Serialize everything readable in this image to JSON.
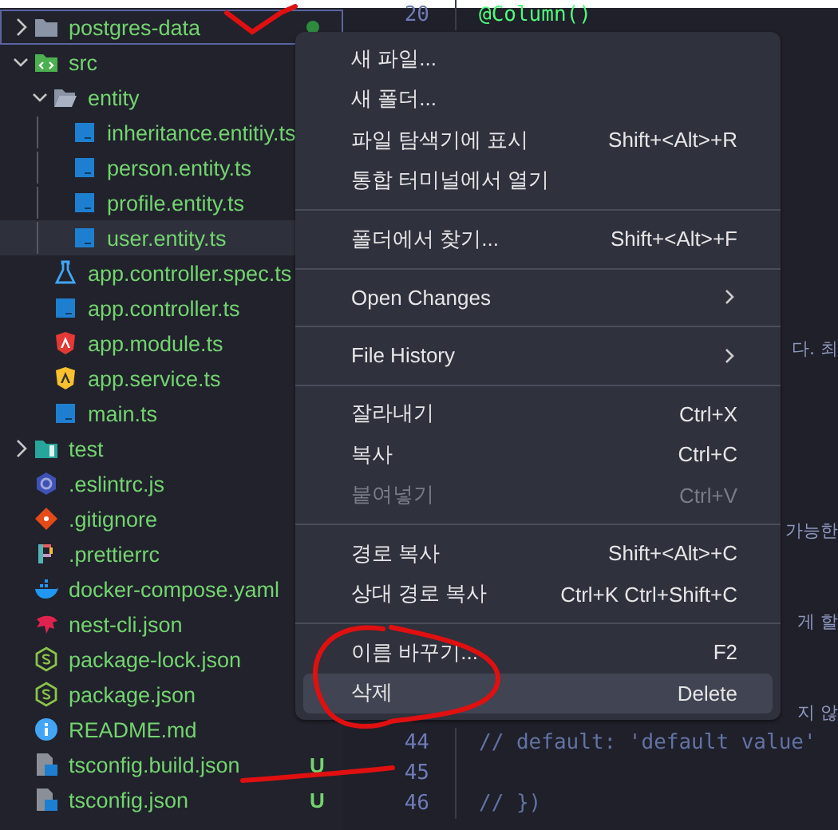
{
  "explorer": {
    "items": [
      {
        "label": "postgres-data",
        "kind": "folder",
        "expanded": false,
        "selected": false,
        "focused": true,
        "dot": true
      },
      {
        "label": "src",
        "kind": "source",
        "expanded": true,
        "selected": false,
        "focused": false,
        "children": [
          {
            "label": "entity",
            "kind": "folder",
            "expanded": true,
            "selected": false,
            "focused": false,
            "children": [
              {
                "label": "inheritance.entitiy.ts",
                "kind": "typescript",
                "selected": false,
                "focused": false
              },
              {
                "label": "person.entity.ts",
                "kind": "typescript",
                "selected": false,
                "focused": false
              },
              {
                "label": "profile.entity.ts",
                "kind": "typescript",
                "selected": false,
                "focused": false
              },
              {
                "label": "user.entity.ts",
                "kind": "typescript",
                "selected": true,
                "focused": false
              }
            ]
          },
          {
            "label": "app.controller.spec.ts",
            "kind": "flask",
            "selected": false,
            "focused": false
          },
          {
            "label": "app.controller.ts",
            "kind": "typescript",
            "selected": false,
            "focused": false
          },
          {
            "label": "app.module.ts",
            "kind": "module",
            "selected": false,
            "focused": false
          },
          {
            "label": "app.service.ts",
            "kind": "service",
            "selected": false,
            "focused": false
          },
          {
            "label": "main.ts",
            "kind": "typescript",
            "selected": false,
            "focused": false
          }
        ]
      },
      {
        "label": "test",
        "kind": "tests",
        "expanded": false,
        "selected": false,
        "focused": false
      },
      {
        "label": ".eslintrc.js",
        "kind": "eslint",
        "selected": false,
        "focused": false
      },
      {
        "label": ".gitignore",
        "kind": "git",
        "selected": false,
        "focused": false
      },
      {
        "label": ".prettierrc",
        "kind": "prettier",
        "selected": false,
        "focused": false
      },
      {
        "label": "docker-compose.yaml",
        "kind": "docker",
        "selected": false,
        "focused": false
      },
      {
        "label": "nest-cli.json",
        "kind": "nest",
        "selected": false,
        "focused": false
      },
      {
        "label": "package-lock.json",
        "kind": "node",
        "selected": false,
        "focused": false
      },
      {
        "label": "package.json",
        "kind": "node",
        "selected": false,
        "focused": false
      },
      {
        "label": "README.md",
        "kind": "info",
        "selected": false,
        "focused": false
      },
      {
        "label": "tsconfig.build.json",
        "kind": "config",
        "selected": false,
        "focused": false,
        "badge": "U"
      },
      {
        "label": "tsconfig.json",
        "kind": "config",
        "selected": false,
        "focused": false,
        "badge": "U"
      }
    ]
  },
  "editor": {
    "lines": [
      {
        "kind": "code",
        "number": "20",
        "text": "@Column()"
      },
      {
        "kind": "covered"
      },
      {
        "kind": "covered"
      },
      {
        "kind": "covered"
      },
      {
        "kind": "covered"
      },
      {
        "kind": "covered"
      },
      {
        "kind": "covered"
      },
      {
        "kind": "covered"
      },
      {
        "kind": "covered"
      },
      {
        "kind": "covered"
      },
      {
        "kind": "covered"
      },
      {
        "kind": "fragment",
        "text": "다. 최"
      },
      {
        "kind": "covered"
      },
      {
        "kind": "covered"
      },
      {
        "kind": "covered"
      },
      {
        "kind": "covered"
      },
      {
        "kind": "covered"
      },
      {
        "kind": "fragment",
        "text": "가능한"
      },
      {
        "kind": "covered"
      },
      {
        "kind": "covered"
      },
      {
        "kind": "fragment",
        "text": "게 할"
      },
      {
        "kind": "covered"
      },
      {
        "kind": "covered"
      },
      {
        "kind": "fragment",
        "text": "지 않"
      },
      {
        "kind": "comment",
        "number": "44",
        "text": "//    default: 'default value'"
      },
      {
        "kind": "code",
        "number": "45"
      },
      {
        "kind": "comment",
        "number": "46",
        "text": "// })"
      }
    ]
  },
  "context_menu": {
    "groups": [
      [
        {
          "label": "새 파일...",
          "selected": false,
          "disabled": false
        },
        {
          "label": "새 폴더...",
          "selected": false,
          "disabled": false
        },
        {
          "label": "파일 탐색기에 표시",
          "shortcut": "Shift+<Alt>+R",
          "selected": false,
          "disabled": false
        },
        {
          "label": "통합 터미널에서 열기",
          "selected": false,
          "disabled": false
        }
      ],
      [
        {
          "label": "폴더에서 찾기...",
          "shortcut": "Shift+<Alt>+F",
          "selected": false,
          "disabled": false
        }
      ],
      [
        {
          "label": "Open Changes",
          "submenu": true,
          "selected": false,
          "disabled": false
        }
      ],
      [
        {
          "label": "File History",
          "submenu": true,
          "selected": false,
          "disabled": false
        }
      ],
      [
        {
          "label": "잘라내기",
          "shortcut": "Ctrl+X",
          "selected": false,
          "disabled": false
        },
        {
          "label": "복사",
          "shortcut": "Ctrl+C",
          "selected": false,
          "disabled": false
        },
        {
          "label": "붙여넣기",
          "shortcut": "Ctrl+V",
          "selected": false,
          "disabled": true
        }
      ],
      [
        {
          "label": "경로 복사",
          "shortcut": "Shift+<Alt>+C",
          "selected": false,
          "disabled": false
        },
        {
          "label": "상대 경로 복사",
          "shortcut": "Ctrl+K Ctrl+Shift+C",
          "selected": false,
          "disabled": false
        }
      ],
      [
        {
          "label": "이름 바꾸기...",
          "shortcut": "F2",
          "selected": false,
          "disabled": false
        },
        {
          "label": "삭제",
          "shortcut": "Delete",
          "selected": true,
          "disabled": false
        }
      ]
    ]
  }
}
